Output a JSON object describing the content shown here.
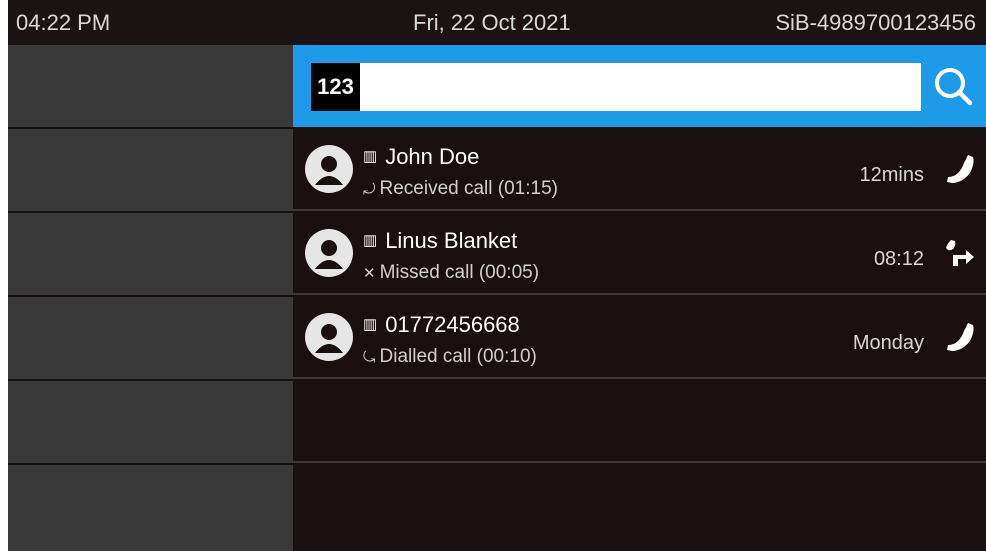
{
  "status": {
    "time": "04:22 PM",
    "date": "Fri, 22 Oct 2021",
    "device_id": "SiB-4989700123456"
  },
  "search": {
    "mode_badge": "123",
    "value": "",
    "icon": "search-icon"
  },
  "calls": [
    {
      "name": "John Doe",
      "detail": "Received call (01:15)",
      "detail_glyph": "⤾",
      "when": "12mins",
      "icon": "phone-icon"
    },
    {
      "name": "Linus Blanket",
      "detail": "Missed call (00:05)",
      "detail_glyph": "✕",
      "when": "08:12",
      "icon": "call-forward-icon"
    },
    {
      "name": "01772456668",
      "detail": "Dialled call (00:10)",
      "detail_glyph": "⤿",
      "when": "Monday",
      "icon": "phone-icon"
    }
  ],
  "colors": {
    "accent": "#1e9be8",
    "background": "#1a0f0f",
    "softkey": "#393939"
  }
}
